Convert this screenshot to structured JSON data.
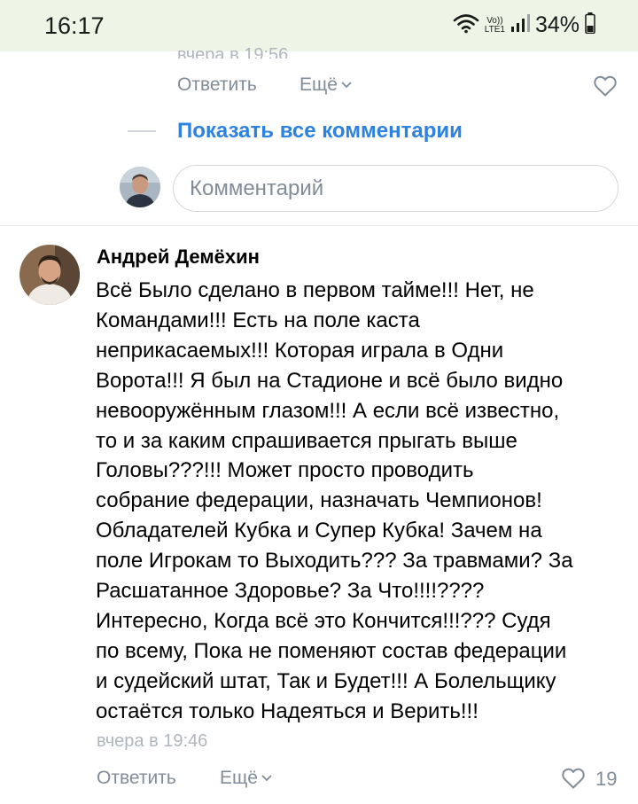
{
  "status_bar": {
    "time": "16:17",
    "volte_top": "Vo))",
    "volte_bottom": "LTE1",
    "battery": "34%"
  },
  "previous_comment": {
    "time_partial": "вчера в 19:56",
    "reply_label": "Ответить",
    "more_label": "Ещё"
  },
  "show_all_comments": "Показать все комментарии",
  "comment_field": {
    "placeholder": "Комментарий"
  },
  "comment": {
    "author": "Андрей Демёхин",
    "text": "Всё Было сделано в первом тайме!!! Нет, не\nКомандами!!! Есть на поле каста\nнеприкасаемых!!! Которая играла в Одни\nВорота!!! Я был на Стадионе и всё было видно\nневооружённым глазом!!! А если всё известно,\nто и за каким спрашивается прыгать выше\nГоловы???!!! Может просто проводить\nсобрание федерации, назначать Чемпионов!\nОбладателей Кубка и Супер Кубка! Зачем на\nполе Игрокам то Выходить??? За травмами? За\nРасшатанное Здоровье? За Что!!!!????\nИнтересно, Когда всё это Кончится!!!??? Судя\nпо всему, Пока не поменяют состав федерации\nи судейский штат, Так и Будет!!! А Болельщику\nостаётся только Надеяться и Верить!!!",
    "time": "вчера в 19:46",
    "reply_label": "Ответить",
    "more_label": "Ещё",
    "likes": "19"
  },
  "colors": {
    "accent": "#2d81e0",
    "secondary_text": "#818c99",
    "status_bar_bg": "#eef5e6"
  }
}
